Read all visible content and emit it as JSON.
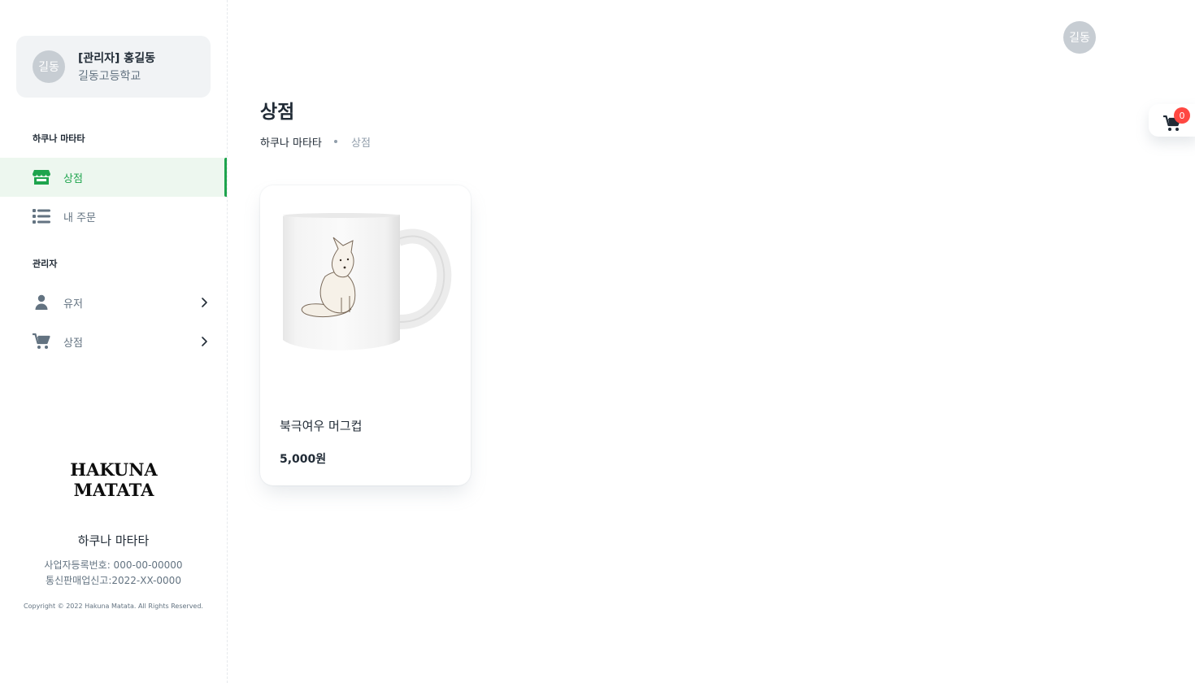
{
  "account": {
    "avatar_text": "길동",
    "name": "[관리자] 홍길동",
    "school": "길동고등학교"
  },
  "sidebar": {
    "sections": [
      {
        "title": "하쿠나 마타타"
      },
      {
        "title": "관리자"
      }
    ],
    "items": [
      {
        "label": "상점",
        "icon": "store-icon",
        "active": true
      },
      {
        "label": "내 주문",
        "icon": "list-icon",
        "active": false
      },
      {
        "label": "유저",
        "icon": "user-icon",
        "active": false
      },
      {
        "label": "상점",
        "icon": "cart-icon",
        "active": false
      }
    ]
  },
  "footer": {
    "logo_line1": "HAKUNA",
    "logo_line2": "MATATA",
    "company_name": "하쿠나 마타타",
    "business_reg": "사업자등록번호: 000-00-00000",
    "telecom_reg": "통신판매업신고:2022-XX-0000",
    "copyright": "Copyright © 2022 Hakuna Matata. All Rights Reserved."
  },
  "header": {
    "avatar_text": "길동"
  },
  "page": {
    "title": "상점",
    "breadcrumb": [
      "하쿠나 마타타",
      "상점"
    ]
  },
  "products": [
    {
      "name": "북극여우 머그컵",
      "price": "5,000원"
    }
  ],
  "cart": {
    "count": "0"
  },
  "colors": {
    "accent": "#1ea44d",
    "active_bg": "#edf7ef",
    "badge": "#ff4842"
  }
}
